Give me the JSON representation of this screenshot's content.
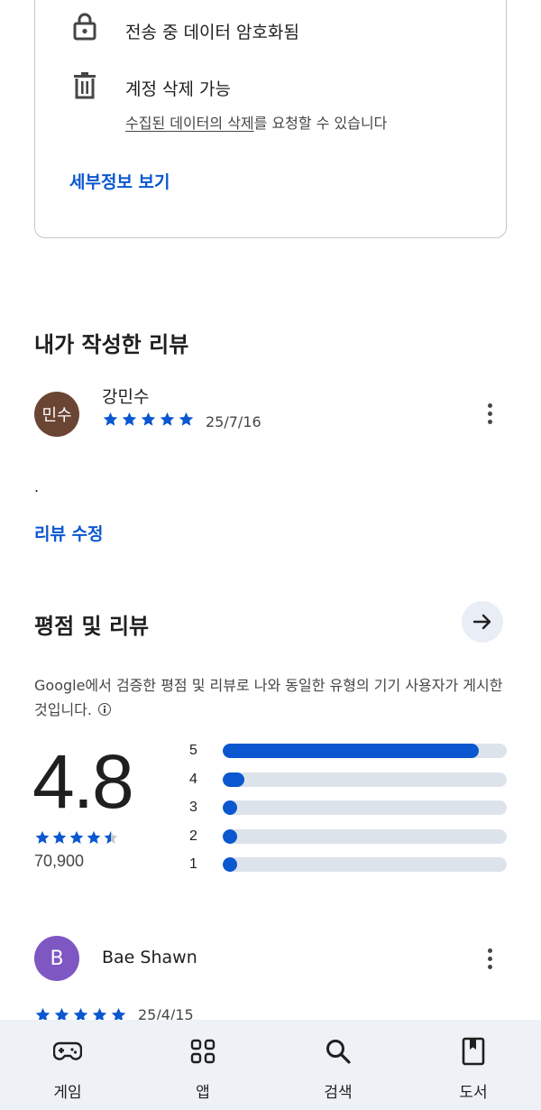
{
  "safety": {
    "encrypted_title": "전송 중 데이터 암호화됨",
    "deletion_title": "계정 삭제 가능",
    "deletion_sub_link": "수집된 데이터의 삭제",
    "deletion_sub_rest": "를 요청할 수 있습니다",
    "details_link": "세부정보 보기",
    "encrypted_icon": "lock-icon",
    "deletion_icon": "trash-icon"
  },
  "my_review": {
    "section_title": "내가 작성한 리뷰",
    "avatar_text": "민수",
    "avatar_color": "#6b4534",
    "reviewer": "강민수",
    "rating": 5,
    "date": "25/7/16",
    "text": ".",
    "edit_link": "리뷰 수정"
  },
  "ratings": {
    "section_title": "평점 및 리뷰",
    "info_text": "Google에서 검증한 평점 및 리뷰로 나와 동일한 유형의 기기 사용자가 게시한 것입니다.",
    "average": "4.8",
    "average_stars": 4.5,
    "count": "70,900",
    "accent": "#0b57d0",
    "distribution": [
      {
        "label": "5",
        "fraction": 0.9
      },
      {
        "label": "4",
        "fraction": 0.075
      },
      {
        "label": "3",
        "fraction": 0.045
      },
      {
        "label": "2",
        "fraction": 0.045
      },
      {
        "label": "1",
        "fraction": 0.045
      }
    ]
  },
  "review2": {
    "avatar_text": "B",
    "avatar_color": "#7e57c2",
    "reviewer": "Bae Shawn",
    "rating": 5,
    "date": "25/4/15"
  },
  "bottom_nav": [
    {
      "label": "게임",
      "icon": "gamepad-icon"
    },
    {
      "label": "앱",
      "icon": "apps-grid-icon"
    },
    {
      "label": "검색",
      "icon": "search-icon"
    },
    {
      "label": "도서",
      "icon": "book-icon"
    }
  ]
}
